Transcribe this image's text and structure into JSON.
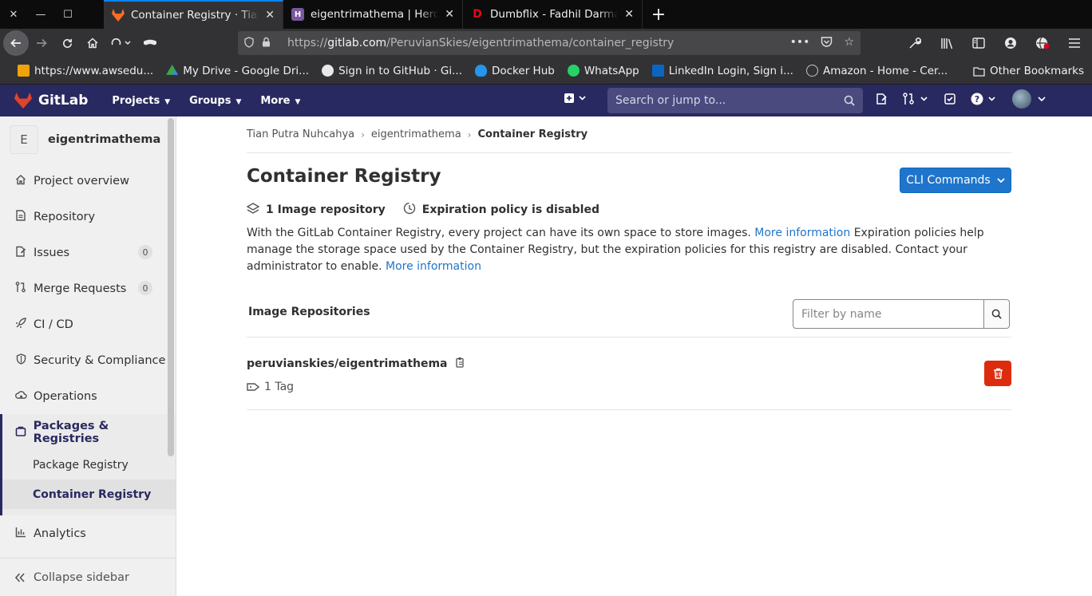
{
  "browser": {
    "window_controls": {
      "close": "✕",
      "minimize": "—",
      "maximize": "☐"
    },
    "tabs": [
      {
        "title": "Container Registry · Tian Putra",
        "favicon": "gitlab-icon"
      },
      {
        "title": "eigentrimathema | Heroku",
        "favicon": "heroku-icon"
      },
      {
        "title": "Dumbflix - Fadhil Darma Putra",
        "favicon": "dumbflix-icon"
      }
    ],
    "url_prefix": "https://",
    "url_domain": "gitlab.com",
    "url_path": "/PeruvianSkies/eigentrimathema/container_registry",
    "bookmarks": [
      {
        "label": "https://www.awsedu...",
        "color": "#f0a30a"
      },
      {
        "label": "My Drive - Google Dri...",
        "color": "#34a853"
      },
      {
        "label": "Sign in to GitHub · Gi...",
        "color": "#e8e8e8"
      },
      {
        "label": "Docker Hub",
        "color": "#2496ed"
      },
      {
        "label": "WhatsApp",
        "color": "#25d366"
      },
      {
        "label": "LinkedIn Login, Sign i...",
        "color": "#0a66c2"
      },
      {
        "label": "Amazon - Home - Cer...",
        "color": "#c8c8c8"
      }
    ],
    "other_bookmarks": "Other Bookmarks"
  },
  "gitlab_header": {
    "brand": "GitLab",
    "menu": [
      "Projects",
      "Groups",
      "More"
    ],
    "search_placeholder": "Search or jump to..."
  },
  "sidebar": {
    "project_initial": "E",
    "project_name": "eigentrimathema",
    "items": [
      {
        "label": "Project overview",
        "icon": "home-icon"
      },
      {
        "label": "Repository",
        "icon": "doc-icon"
      },
      {
        "label": "Issues",
        "icon": "issues-icon",
        "count": "0"
      },
      {
        "label": "Merge Requests",
        "icon": "merge-request-icon",
        "count": "0"
      },
      {
        "label": "CI / CD",
        "icon": "rocket-icon"
      },
      {
        "label": "Security & Compliance",
        "icon": "shield-icon"
      },
      {
        "label": "Operations",
        "icon": "cloud-gear-icon"
      }
    ],
    "active_group": {
      "label": "Packages & Registries",
      "sub": [
        "Package Registry",
        "Container Registry"
      ]
    },
    "analytics": "Analytics",
    "collapse": "Collapse sidebar"
  },
  "main": {
    "breadcrumb": [
      "Tian Putra Nuhcahya",
      "eigentrimathema",
      "Container Registry"
    ],
    "title": "Container Registry",
    "cli_button": "CLI Commands",
    "image_count": "1 Image repository",
    "expiration": "Expiration policy is disabled",
    "desc_1": "With the GitLab Container Registry, every project can have its own space to store images.",
    "desc_link_1": "More information",
    "desc_2": "Expiration policies help manage the storage space used by the Container Registry, but the expiration policies for this registry are disabled. Contact your administrator to enable.",
    "desc_link_2": "More information",
    "repos_header": "Image Repositories",
    "filter_placeholder": "Filter by name",
    "repo": {
      "name": "peruvianskies/eigentrimathema",
      "tags": "1 Tag"
    }
  }
}
